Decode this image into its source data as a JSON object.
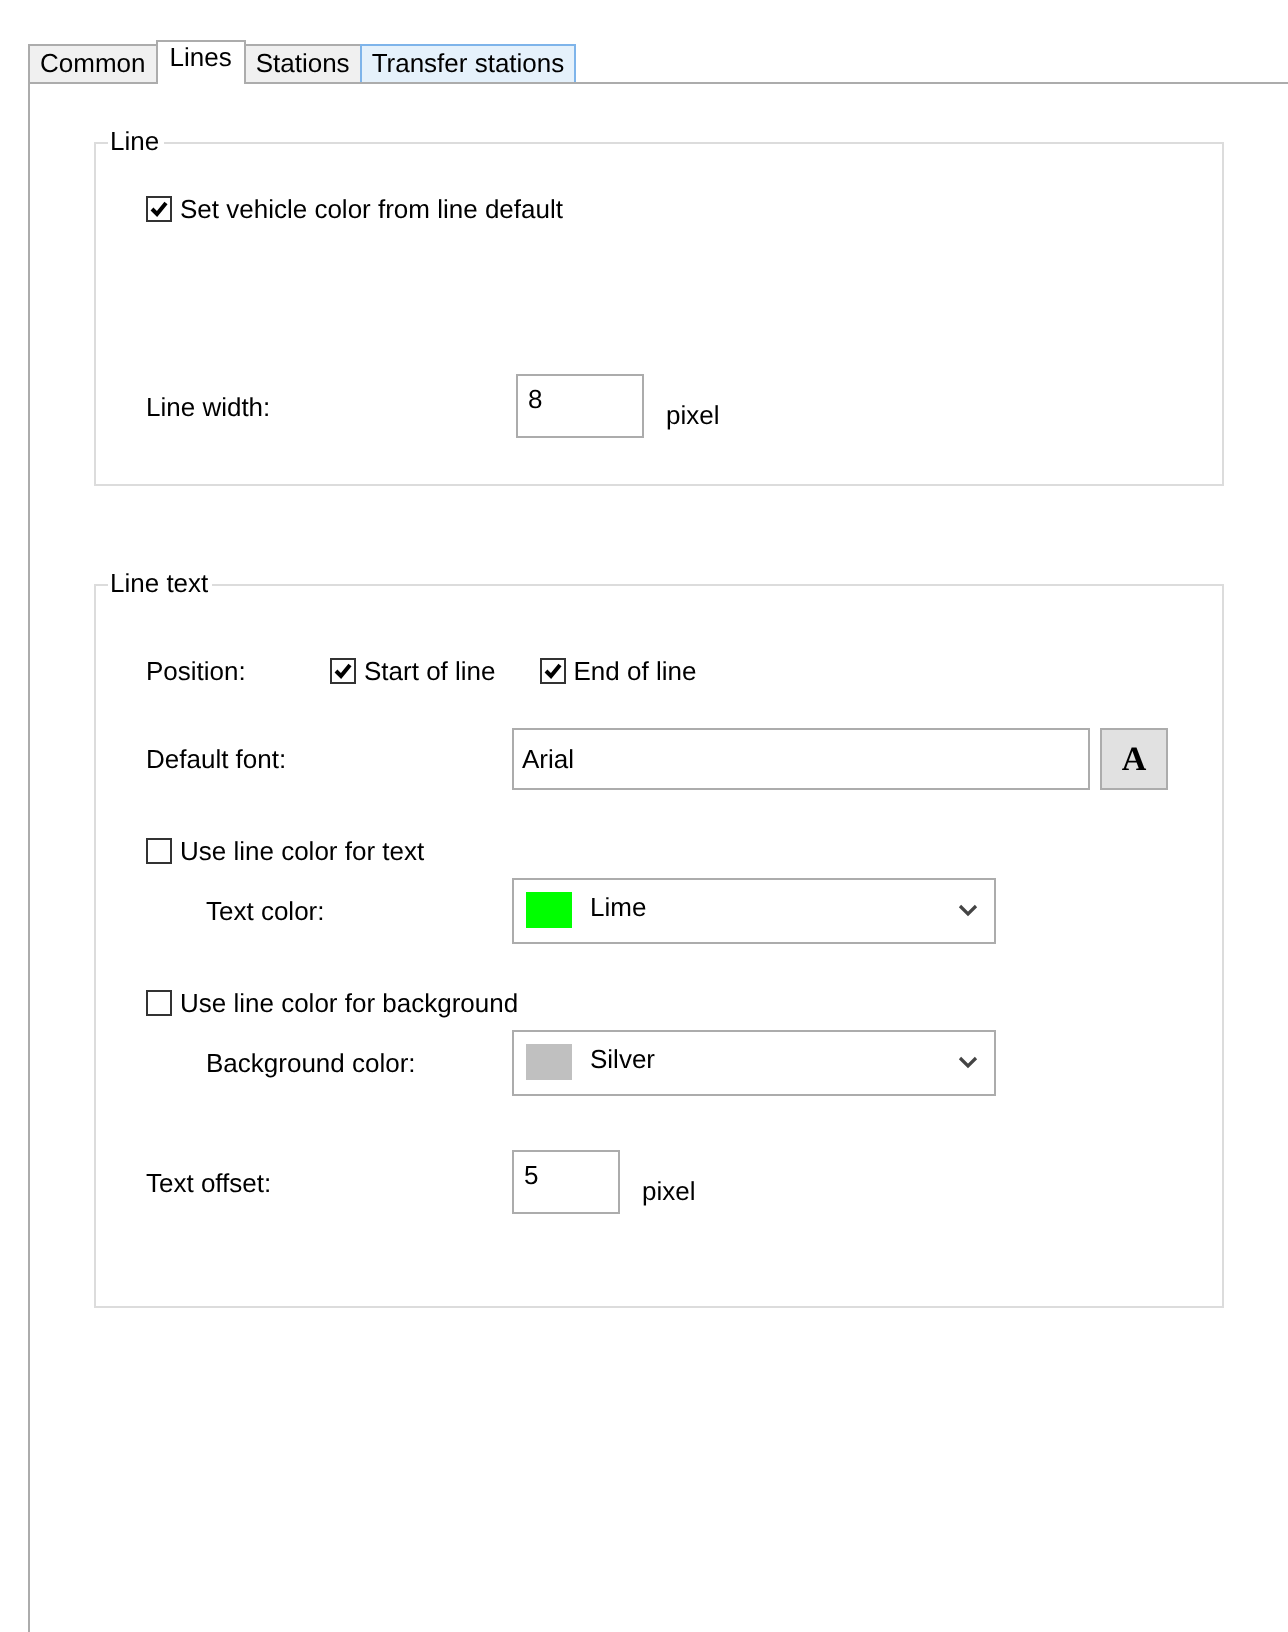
{
  "tabs": [
    {
      "label": "Common",
      "selected": false,
      "hovered": false
    },
    {
      "label": "Lines",
      "selected": true,
      "hovered": false
    },
    {
      "label": "Stations",
      "selected": false,
      "hovered": false
    },
    {
      "label": "Transfer stations",
      "selected": false,
      "hovered": true
    }
  ],
  "line_group": {
    "title": "Line",
    "vehicle_color": {
      "label": "Set vehicle color from line default",
      "checked": true
    },
    "line_width": {
      "label": "Line width:",
      "value": "8",
      "unit": "pixel"
    }
  },
  "line_text_group": {
    "title": "Line text",
    "position": {
      "label": "Position:",
      "options": [
        {
          "label": "Start of line",
          "checked": true
        },
        {
          "label": "End of line",
          "checked": true
        }
      ]
    },
    "default_font": {
      "label": "Default font:",
      "value": "Arial",
      "button": "A"
    },
    "text_color": {
      "use_line_color": {
        "label": "Use line color for text",
        "checked": false
      },
      "label": "Text color:",
      "value": "Lime",
      "color": "#00ff00"
    },
    "background_color": {
      "use_line_color": {
        "label": "Use line color for background",
        "checked": false
      },
      "label": "Background color:",
      "value": "Silver",
      "color": "#c0c0c0"
    },
    "text_offset": {
      "label": "Text offset:",
      "value": "5",
      "unit": "pixel"
    }
  }
}
